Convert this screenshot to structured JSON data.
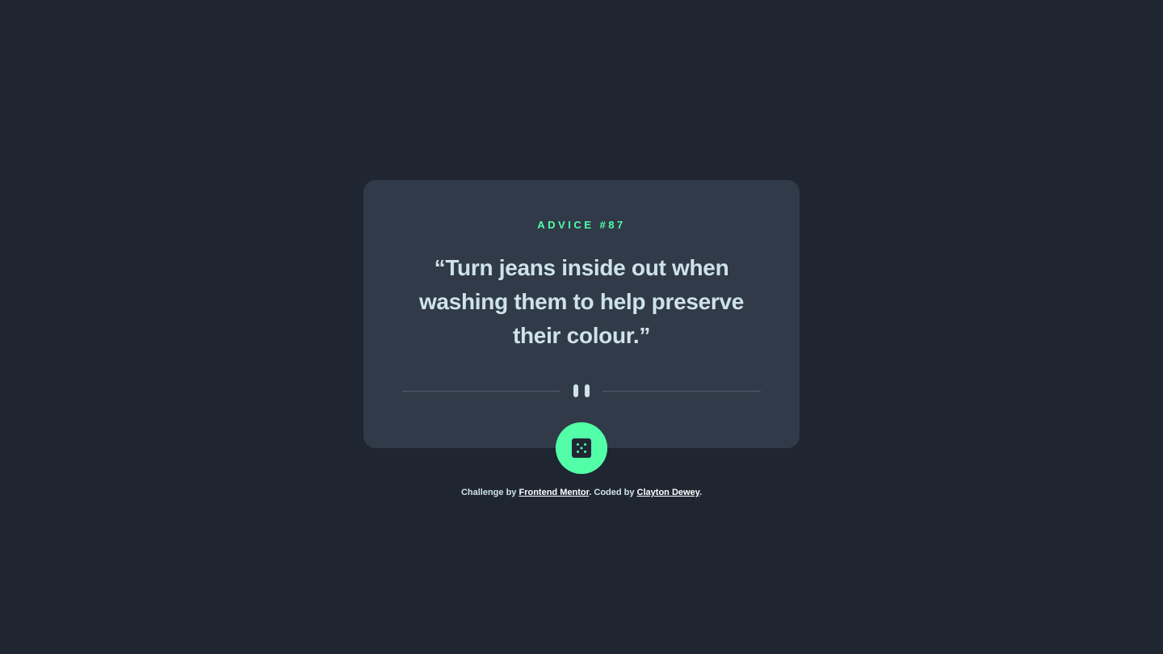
{
  "card": {
    "advice_label": "ADVICE #87",
    "quote": "“Turn jeans inside out when washing them to help preserve their colour.”"
  },
  "dice_button": {
    "icon": "dice-icon",
    "aria_label": "Get new advice"
  },
  "attribution": {
    "prefix": "Challenge by ",
    "challenge_link": "Frontend Mentor",
    "middle": ". Coded by ",
    "author_link": "Clayton Dewey",
    "suffix": "."
  },
  "colors": {
    "background": "#1f2632",
    "card": "#313a48",
    "accent": "#52ffa8",
    "text": "#cee3e9",
    "divider": "#4f5d74"
  }
}
